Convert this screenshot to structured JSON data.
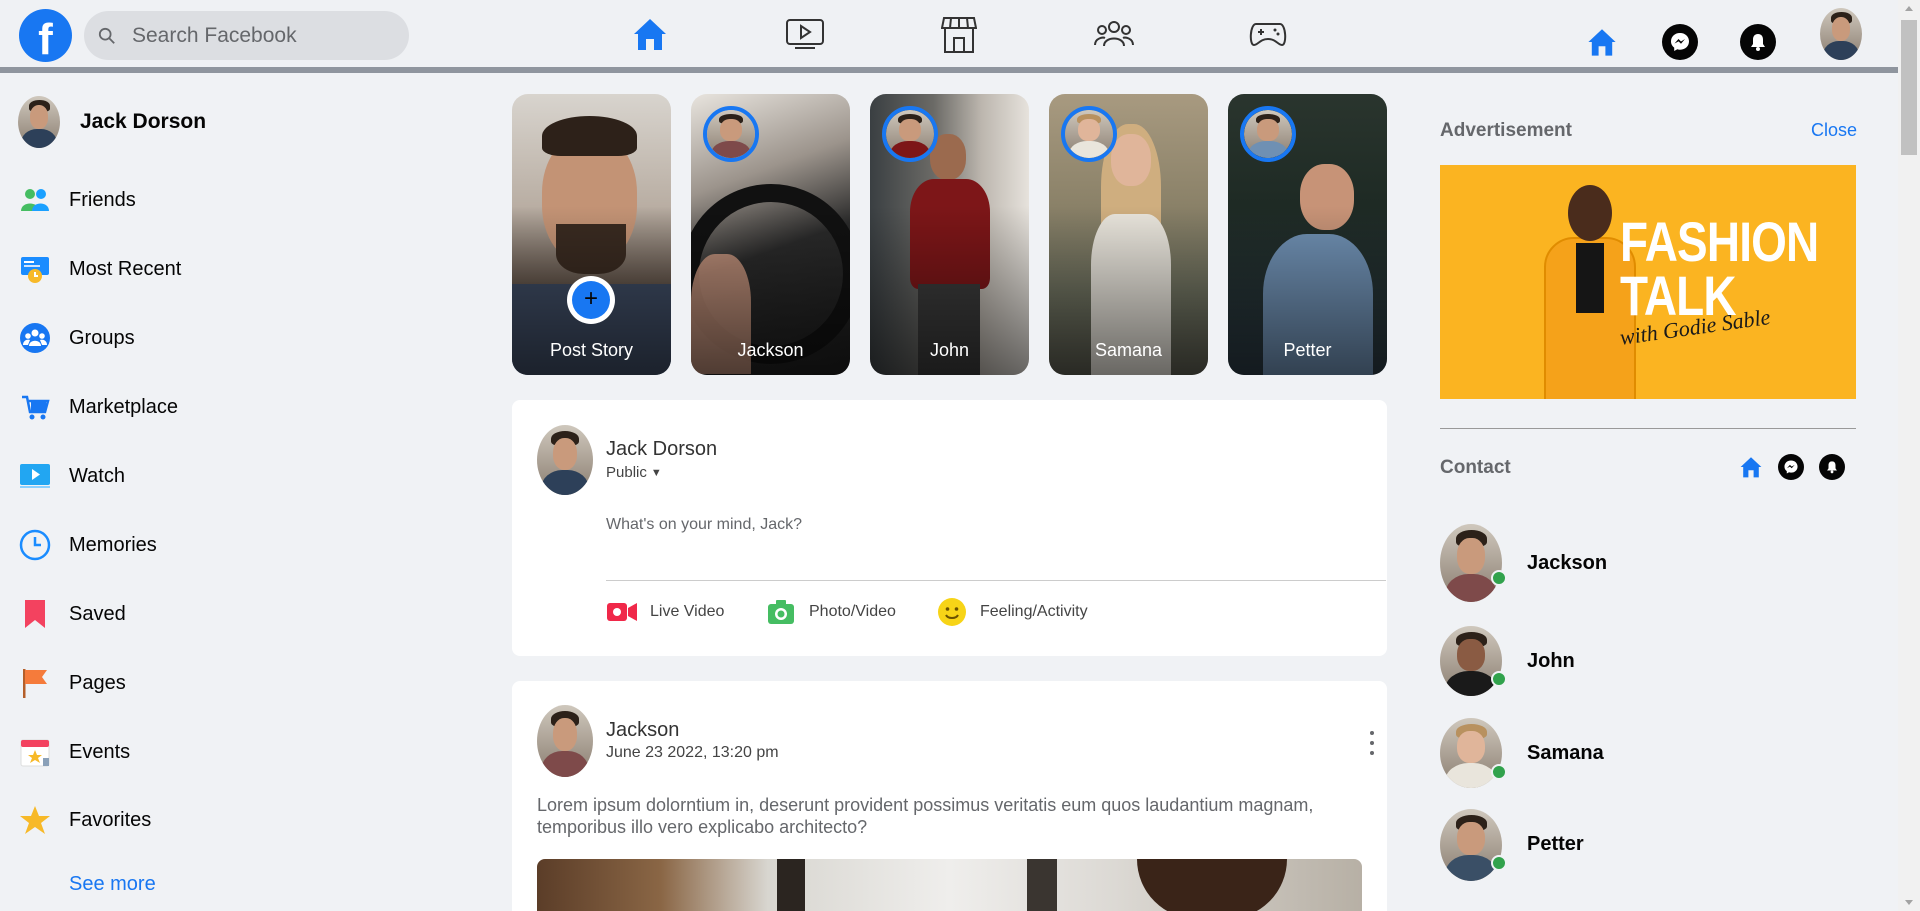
{
  "header": {
    "logo_letter": "f",
    "search_placeholder": "Search Facebook",
    "nav_icons": [
      "home-icon",
      "watch-icon",
      "marketplace-icon",
      "groups-icon",
      "gaming-icon"
    ],
    "right_icons": [
      "home-icon",
      "messenger-icon",
      "notifications-icon"
    ]
  },
  "sidebar": {
    "profile_name": "Jack Dorson",
    "items": [
      {
        "label": "Friends",
        "icon": "friends-icon"
      },
      {
        "label": "Most Recent",
        "icon": "most-recent-icon"
      },
      {
        "label": "Groups",
        "icon": "groups-icon"
      },
      {
        "label": "Marketplace",
        "icon": "marketplace-icon"
      },
      {
        "label": "Watch",
        "icon": "watch-icon"
      },
      {
        "label": "Memories",
        "icon": "memories-icon"
      },
      {
        "label": "Saved",
        "icon": "saved-icon"
      },
      {
        "label": "Pages",
        "icon": "pages-icon"
      },
      {
        "label": "Events",
        "icon": "events-icon"
      },
      {
        "label": "Favorites",
        "icon": "favorites-icon"
      }
    ],
    "see_more": "See more"
  },
  "stories": [
    {
      "label": "Post Story"
    },
    {
      "label": "Jackson"
    },
    {
      "label": "John"
    },
    {
      "label": "Samana"
    },
    {
      "label": "Petter"
    }
  ],
  "create_post": {
    "name": "Jack Dorson",
    "privacy": "Public",
    "placeholder": "What's on your mind, Jack?",
    "actions": [
      {
        "label": "Live Video",
        "icon": "live-video-icon"
      },
      {
        "label": "Photo/Video",
        "icon": "photo-icon"
      },
      {
        "label": "Feeling/Activity",
        "icon": "feeling-icon"
      }
    ]
  },
  "post": {
    "author": "Jackson",
    "date": "June 23 2022, 13:20 pm",
    "text": "Lorem ipsum dolorntium in, deserunt provident possimus veritatis eum quos laudantium magnam, temporibus illo vero explicabo architecto?"
  },
  "advertisement": {
    "title": "Advertisement",
    "close": "Close",
    "headline_line1": "FASHION",
    "headline_line2": "TALK",
    "subline": "with Godie Sable"
  },
  "contacts": {
    "title": "Contact",
    "icons": [
      "home-icon",
      "messenger-icon",
      "notifications-icon"
    ],
    "people": [
      {
        "name": "Jackson",
        "online": true
      },
      {
        "name": "John",
        "online": true
      },
      {
        "name": "Samana",
        "online": true
      },
      {
        "name": "Petter",
        "online": true
      }
    ]
  },
  "colors": {
    "brand_blue": "#1877f2",
    "online_green": "#31a24c",
    "ad_yellow": "#fbb421"
  }
}
